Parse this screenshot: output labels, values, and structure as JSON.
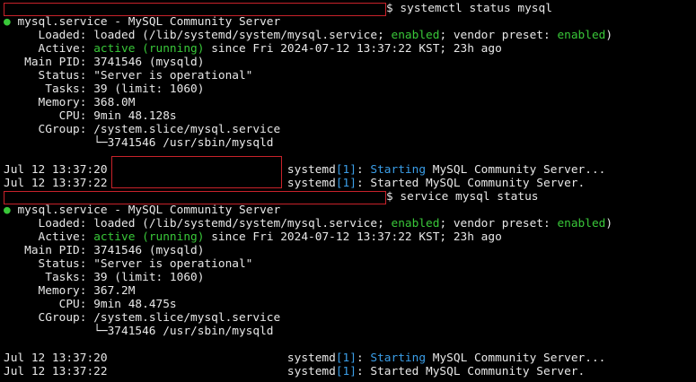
{
  "session1": {
    "command": "$ systemctl status mysql",
    "unit": "mysql.service - MySQL Community Server",
    "loaded_label": "Loaded:",
    "loaded_pre": "loaded (/lib/systemd/system/mysql.service;",
    "loaded_enabled": "enabled",
    "loaded_mid": "; vendor preset:",
    "loaded_preset": "enabled",
    "loaded_end": ")",
    "active_label": "Active:",
    "active_state": "active (running)",
    "active_rest": "since Fri 2024-07-12 13:37:22 KST; 23h ago",
    "pid_label": "Main PID:",
    "pid_value": "3741546 (mysqld)",
    "status_label": "Status:",
    "status_value": "\"Server is operational\"",
    "tasks_label": "Tasks:",
    "tasks_value": "39 (limit: 1060)",
    "memory_label": "Memory:",
    "memory_value": "368.0M",
    "cpu_label": "CPU:",
    "cpu_value": "9min 48.128s",
    "cgroup_label": "CGroup:",
    "cgroup_value": "/system.slice/mysql.service",
    "cgroup_child": "└─3741546 /usr/sbin/mysqld",
    "log1_time": "Jul 12 13:37:20",
    "log1_proc": "systemd",
    "log1_pid": "[1]",
    "log1_verb": "Starting",
    "log1_rest": "MySQL Community Server...",
    "log2_time": "Jul 12 13:37:22",
    "log2_proc": "systemd",
    "log2_pid": "[1]",
    "log2_rest": ": Started MySQL Community Server."
  },
  "session2": {
    "command": "$ service mysql status",
    "unit": "mysql.service - MySQL Community Server",
    "loaded_label": "Loaded:",
    "loaded_pre": "loaded (/lib/systemd/system/mysql.service;",
    "loaded_enabled": "enabled",
    "loaded_mid": "; vendor preset:",
    "loaded_preset": "enabled",
    "loaded_end": ")",
    "active_label": "Active:",
    "active_state": "active (running)",
    "active_rest": "since Fri 2024-07-12 13:37:22 KST; 23h ago",
    "pid_label": "Main PID:",
    "pid_value": "3741546 (mysqld)",
    "status_label": "Status:",
    "status_value": "\"Server is operational\"",
    "tasks_label": "Tasks:",
    "tasks_value": "39 (limit: 1060)",
    "memory_label": "Memory:",
    "memory_value": "367.2M",
    "cpu_label": "CPU:",
    "cpu_value": "9min 48.475s",
    "cgroup_label": "CGroup:",
    "cgroup_value": "/system.slice/mysql.service",
    "cgroup_child": "└─3741546 /usr/sbin/mysqld",
    "log1_time": "Jul 12 13:37:20",
    "log1_proc": "systemd",
    "log1_pid": "[1]",
    "log1_verb": "Starting",
    "log1_rest": "MySQL Community Server...",
    "log2_time": "Jul 12 13:37:22",
    "log2_proc": "systemd",
    "log2_pid": "[1]",
    "log2_rest": ": Started MySQL Community Server."
  },
  "icons": {
    "status_dot": "●"
  },
  "colors": {
    "background": "#000000",
    "text": "#e8e8e8",
    "green": "#39c839",
    "blue": "#3a9ee8",
    "redaction_border": "#c8222a"
  }
}
